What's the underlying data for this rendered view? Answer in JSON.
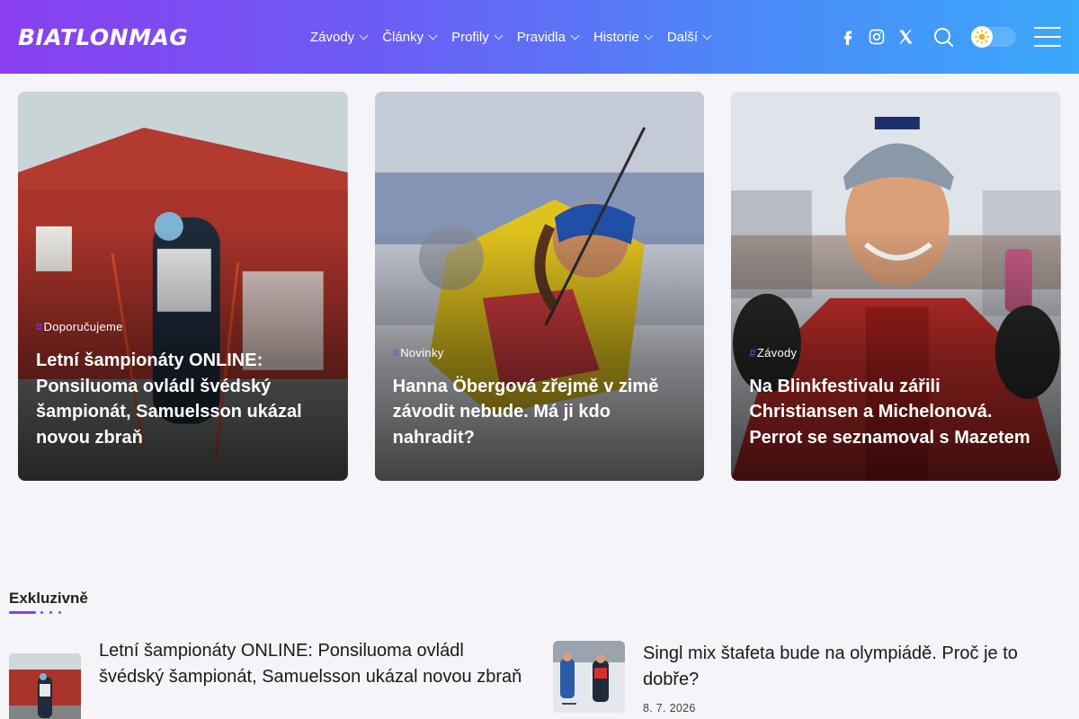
{
  "header": {
    "logo": "BIATLONMAG",
    "nav": [
      "Závody",
      "Články",
      "Profily",
      "Pravidla",
      "Historie",
      "Další"
    ]
  },
  "featured": [
    {
      "category": "Doporučujeme",
      "title": "Letní šampionáty ONLINE: Ponsiluoma ovládl švédský šampionát, Samuelsson ukázal novou zbraň"
    },
    {
      "category": "Novinky",
      "title": "Hanna Öbergová zřejmě v zimě závodit nebude. Má ji kdo nahradit?"
    },
    {
      "category": "Závody",
      "title": "Na Blinkfestivalu zářili Christiansen a Michelonová. Perrot se seznamoval s Mazetem"
    }
  ],
  "exclusive": {
    "heading": "Exkluzivně",
    "items": [
      {
        "title": "Letní šampionáty ONLINE: Ponsiluoma ovládl švédský šampionát, Samuelsson ukázal novou zbraň",
        "date": ""
      },
      {
        "title": "Singl mix štafeta bude na olympiádě. Proč je to dobře?",
        "date": "8. 7. 2026"
      }
    ]
  },
  "colors": {
    "accent": "#8a3ff0",
    "header_start": "#8a3ff0",
    "header_end": "#3aa8fb"
  }
}
